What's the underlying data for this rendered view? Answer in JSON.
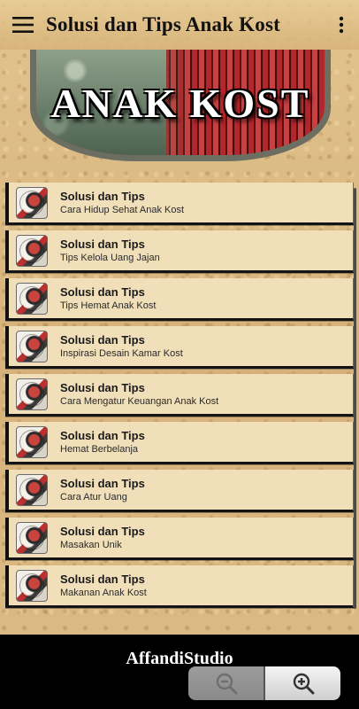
{
  "appbar": {
    "title": "Solusi dan Tips Anak Kost",
    "menu_icon": "hamburger-menu-icon",
    "overflow_icon": "more-vert-icon"
  },
  "banner": {
    "text": "ANAK KOST"
  },
  "list": {
    "items": [
      {
        "title": "Solusi dan Tips",
        "subtitle": "Cara Hidup Sehat Anak Kost"
      },
      {
        "title": "Solusi dan Tips",
        "subtitle": "Tips Kelola Uang Jajan"
      },
      {
        "title": "Solusi dan Tips",
        "subtitle": "Tips Hemat Anak Kost"
      },
      {
        "title": "Solusi dan Tips",
        "subtitle": "Inspirasi Desain Kamar Kost"
      },
      {
        "title": "Solusi dan Tips",
        "subtitle": "Cara Mengatur Keuangan Anak Kost"
      },
      {
        "title": "Solusi dan Tips",
        "subtitle": "Hemat Berbelanja"
      },
      {
        "title": "Solusi dan Tips",
        "subtitle": "Cara Atur Uang"
      },
      {
        "title": "Solusi dan Tips",
        "subtitle": "Masakan Unik"
      },
      {
        "title": "Solusi dan Tips",
        "subtitle": "Makanan Anak Kost"
      }
    ]
  },
  "footer": {
    "brand": "AffandiStudio",
    "zoom_out_icon": "zoom-out-icon",
    "zoom_in_icon": "zoom-in-icon"
  },
  "colors": {
    "list_item_bg": "#f0dfb9",
    "page_bg": "#d9b884",
    "footer_bg": "#000000"
  }
}
